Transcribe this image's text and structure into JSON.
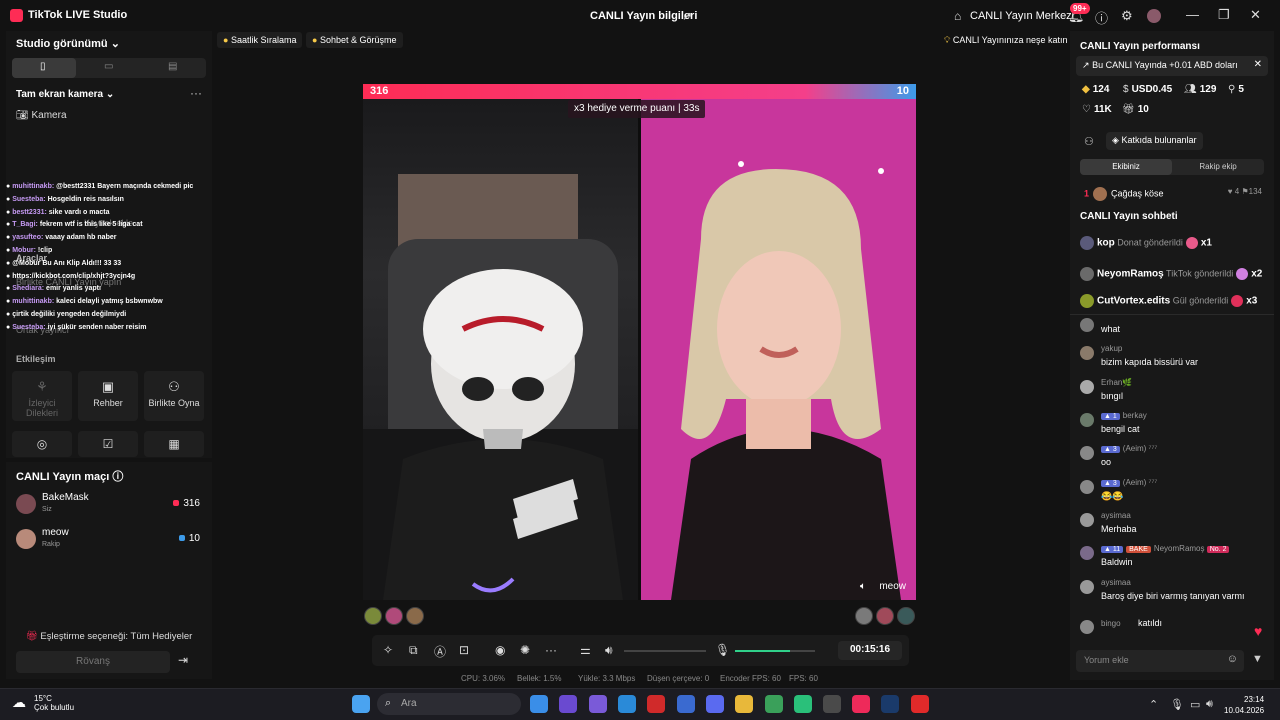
{
  "app": {
    "title": "TikTok LIVE Studio",
    "center_title": "CANLI Yayın bilgileri",
    "live_center": "CANLI Yayın Merkezi",
    "notif_badge": "99+"
  },
  "left": {
    "studio_view": "Studio görünümü",
    "camera_section": "Tam ekran kamera",
    "camera_item": "Kamera",
    "chat_overlay": [
      {
        "user": "muhittinakb:",
        "text": "@bestt2331 Bayern maçında cekmedi pic"
      },
      {
        "user": "Suesteba:",
        "text": "Hosgeldin reis nasılsın"
      },
      {
        "user": "bestt2331:",
        "text": "sike vardı o macta"
      },
      {
        "user": "T_Bagi:",
        "text": "fekrem wtf is this like 5 liga cat"
      },
      {
        "user": "yasufteo:",
        "text": "vaaay adam hb naber"
      },
      {
        "user": "Mobur:",
        "text": "!clip"
      },
      {
        "user": "",
        "text": "@Mobur Bu Anı Klip Aldı!!! 33 33"
      },
      {
        "user": "",
        "text": "https://kickbot.com/clip/xhjt?3ycjn4g"
      },
      {
        "user": "Shediara:",
        "text": "emir yanlis yaptı"
      },
      {
        "user": "muhittinakb:",
        "text": "kaleci delayli yatmış bsbwnwbw"
      },
      {
        "user": "",
        "text": "çirtik değiliki yengeden değilmiydi"
      },
      {
        "user": "Suesteba:",
        "text": "iyi şükür senden naber reisim"
      }
    ],
    "ghost": {
      "kaynak": "Kaynak ekle",
      "araclar": "Araçlar",
      "birlikte": "Birlikte CANLI Yayın yapın",
      "ortak": "Ortak yayıncı"
    },
    "interaction_title": "Etkileşim",
    "interactions": [
      {
        "label": "İzleyici Dilekleri",
        "icon": "viewer-wishes-icon"
      },
      {
        "label": "Rehber",
        "icon": "guide-icon"
      },
      {
        "label": "Birlikte Oyna",
        "icon": "play-together-icon"
      }
    ],
    "match": {
      "title": "CANLI Yayın maçı",
      "players": [
        {
          "name": "BakeMask",
          "sub": "Siz",
          "score": "316",
          "color": "#fe2c55"
        },
        {
          "name": "meow",
          "sub": "Rakip",
          "score": "10",
          "color": "#3d9be9"
        }
      ],
      "pairing": "Eşleştirme seçeneği: Tüm Hediyeler",
      "rematch": "Rövanş"
    }
  },
  "chips": {
    "hourly": "Saatlik Sıralama",
    "chat": "Sohbet & Görüşme",
    "joy": "CANLI Yayınınıza neşe katın"
  },
  "stage": {
    "left_score": "316",
    "right_score": "10",
    "gift_points": "x3 hediye verme puanı",
    "timer": "33s",
    "opponent_label": "meow"
  },
  "controls": {
    "time": "00:15:16"
  },
  "stats": {
    "cpu": "CPU: 3.06%",
    "mem": "Bellek: 1.5%",
    "upload": "Yükle: 3.3 Mbps",
    "dropped": "Düşen çerçeve: 0",
    "encoder": "Encoder FPS: 60",
    "fps": "FPS: 60"
  },
  "right": {
    "perf_title": "CANLI Yayın performansı",
    "notice": "Bu CANLI Yayında +0.01 ABD doları",
    "stats": {
      "coins": "124",
      "usd": "USD0.45",
      "viewers": "129",
      "new": "5",
      "likes": "11K",
      "gifts": "10"
    },
    "contributors": "Katkıda bulunanlar",
    "team_tabs": [
      "Ekibiniz",
      "Rakip ekip"
    ],
    "rank": {
      "n": "1",
      "name": "Çağdaş köse",
      "likes": "4",
      "points": "134"
    },
    "chat_title": "CANLI Yayın sohbeti",
    "gift_events": [
      {
        "user": "kop",
        "desc": "Donat gönderildi",
        "count": "x1"
      },
      {
        "user": "NeyomRamoş",
        "desc": "TikTok gönderildi",
        "count": "x2"
      },
      {
        "user": "CutVortex.edits",
        "desc": "Gül gönderildi",
        "count": "x3"
      }
    ],
    "messages": [
      {
        "user": "",
        "text": "what",
        "level": "",
        "fan": "",
        "rank": ""
      },
      {
        "user": "yakup",
        "text": "bizim kapıda bissürü var",
        "level": "",
        "fan": "",
        "rank": ""
      },
      {
        "user": "Erhan🌿",
        "text": "bıngıl",
        "level": "",
        "fan": "",
        "rank": ""
      },
      {
        "user": "berkay",
        "text": "bengil cat",
        "level": "1",
        "fan": "",
        "rank": ""
      },
      {
        "user": "(Aeim) ⁷⁷⁷",
        "text": "oo",
        "level": "3",
        "fan": "",
        "rank": ""
      },
      {
        "user": "(Aeim) ⁷⁷⁷",
        "text": "😂😂",
        "level": "3",
        "fan": "",
        "rank": ""
      },
      {
        "user": "aysimaa",
        "text": "Merhaba",
        "level": "",
        "fan": "",
        "rank": ""
      },
      {
        "user": "NeyomRamoş",
        "text": "Baldwin",
        "level": "11",
        "fan": "BAKE",
        "rank": "No. 2"
      },
      {
        "user": "aysimaa",
        "text": "Baroş diye biri varmış tanıyan varmı",
        "level": "",
        "fan": "",
        "rank": ""
      },
      {
        "user": "bingo",
        "text": "katıldı",
        "level": "",
        "fan": "",
        "rank": ""
      }
    ],
    "comment_placeholder": "Yorum ekle"
  },
  "taskbar": {
    "temp": "15°C",
    "weather": "Çok bulutlu",
    "search": "Ara",
    "time": "23:14",
    "date": "10.04.2026"
  }
}
